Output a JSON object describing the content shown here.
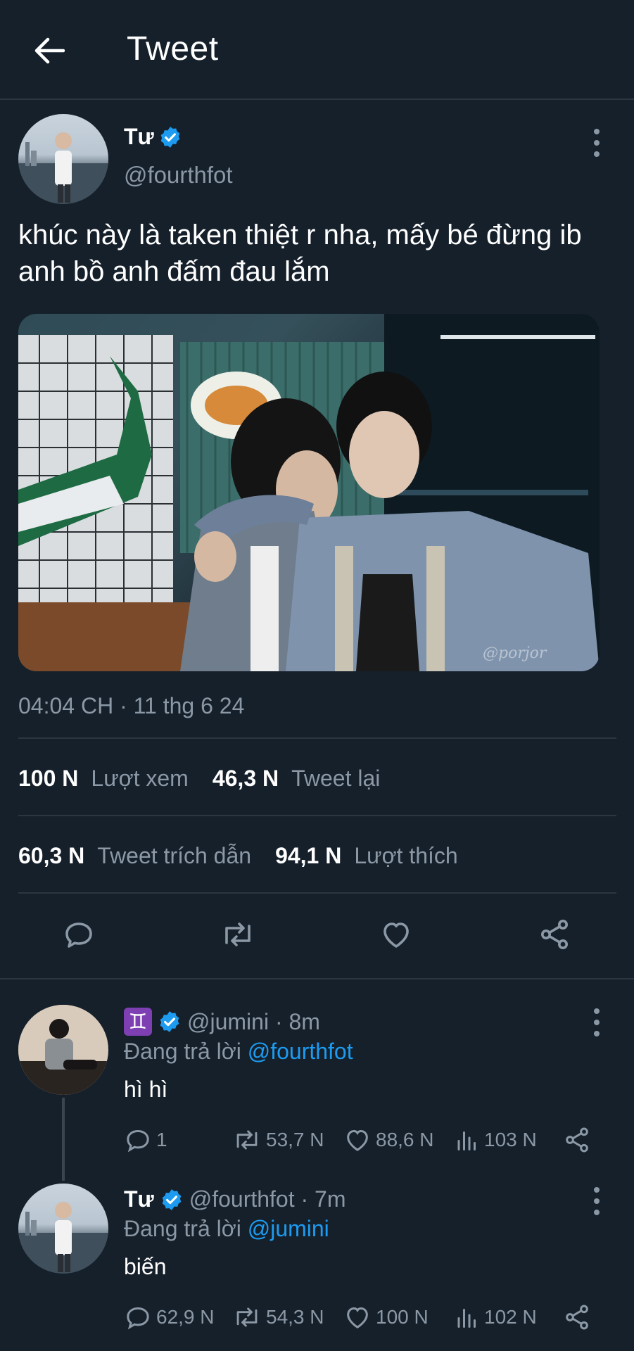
{
  "header": {
    "title": "Tweet"
  },
  "tweet": {
    "author_name": "Tư",
    "handle": "@fourthfot",
    "text": "khúc này là taken thiệt r nha, mấy bé đừng ib anh bồ anh đấm đau lắm",
    "media_watermark": "@porjor",
    "timestamp": "04:04 CH · 11 thg 6 24",
    "stats": {
      "views_value": "100 N",
      "views_label": "Lượt xem",
      "retweets_value": "46,3 N",
      "retweets_label": "Tweet lại",
      "quotes_value": "60,3 N",
      "quotes_label": "Tweet trích dẫn",
      "likes_value": "94,1 N",
      "likes_label": "Lượt thích"
    }
  },
  "replies": [
    {
      "emoji": "♊",
      "handle_time": "@jumini · 8m",
      "replying_prefix": "Đang trả lời",
      "replying_to": "@fourthfot",
      "text": "hì hì",
      "reply_count": "1",
      "retweet_count": "53,7 N",
      "like_count": "88,6 N",
      "view_count": "103 N"
    },
    {
      "author_name": "Tư",
      "handle_time": "@fourthfot · 7m",
      "replying_prefix": "Đang trả lời",
      "replying_to": "@jumini",
      "text": "biến",
      "reply_count": "62,9 N",
      "retweet_count": "54,3 N",
      "like_count": "100 N",
      "view_count": "102 N"
    }
  ],
  "colors": {
    "background": "#15202b",
    "accent": "#1d9bf0",
    "muted": "#8b98a5",
    "divider": "#2b3640"
  }
}
